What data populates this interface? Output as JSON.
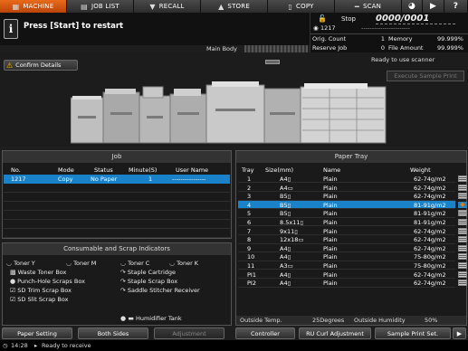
{
  "nav": {
    "tabs": [
      {
        "label": "MACHINE",
        "icon": "machine-icon"
      },
      {
        "label": "JOB LIST",
        "icon": "job-list-icon"
      },
      {
        "label": "RECALL",
        "icon": "recall-icon"
      },
      {
        "label": "STORE",
        "icon": "store-icon"
      },
      {
        "label": "COPY",
        "icon": "copy-icon"
      },
      {
        "label": "SCAN",
        "icon": "scan-icon"
      }
    ],
    "utility_icons": [
      "globe-icon",
      "volume-icon",
      "help-icon"
    ]
  },
  "message": {
    "icon": "i",
    "text": "Press [Start] to restart"
  },
  "status": {
    "state": "Stop",
    "counter": "0000/0001",
    "user": "1217",
    "user_dashes": "-----------------------",
    "orig_count_label": "Orig. Count",
    "orig_count_value": "1",
    "memory_label": "Memory",
    "memory_value": "99.999%",
    "reserve_job_label": "Reserve Job",
    "reserve_job_value": "0",
    "file_amount_label": "File Amount",
    "file_amount_value": "99.999%"
  },
  "machine": {
    "main_body_label": "Main Body",
    "confirm_details_label": "Confirm Details",
    "ready_text": "Ready to use scanner",
    "execute_sample_label": "Execute Sample Print"
  },
  "job": {
    "title": "Job",
    "headers": [
      "No.",
      "Mode",
      "Status",
      "Minute(S)",
      "User Name"
    ],
    "rows": [
      {
        "no": "1217",
        "mode": "Copy",
        "status": "No Paper",
        "minutes": "1",
        "user": "----------------"
      }
    ]
  },
  "consumables": {
    "title": "Consumable and Scrap Indicators",
    "items": [
      {
        "label": "Toner Y",
        "icon": "toner-y-icon"
      },
      {
        "label": "Toner M",
        "icon": "toner-m-icon"
      },
      {
        "label": "Toner C",
        "icon": "toner-c-icon"
      },
      {
        "label": "Toner K",
        "icon": "toner-k-icon"
      },
      {
        "label": "Waste Toner Box",
        "icon": "waste-toner-icon"
      },
      {
        "label": "Staple Cartridge",
        "icon": "staple-icon"
      },
      {
        "label": "Punch-Hole Scraps Box",
        "icon": "punch-icon"
      },
      {
        "label": "Staple Scrap Box",
        "icon": "staple-scrap-icon"
      },
      {
        "label": "SD Trim Scrap Box",
        "icon": "trim-icon"
      },
      {
        "label": "Saddle Stitcher Receiver",
        "icon": "saddle-icon"
      },
      {
        "label": "SD Slit Scrap Box",
        "icon": "slit-icon"
      },
      {
        "label": "Humidifier Tank",
        "icon": "humidifier-icon"
      }
    ]
  },
  "tray": {
    "title": "Paper Tray",
    "headers": [
      "Tray",
      "Size(mm)",
      "Name",
      "Weight"
    ],
    "rows": [
      {
        "tray": "1",
        "size": "A4▯",
        "name": "Plain",
        "weight": "62-74g/m2"
      },
      {
        "tray": "2",
        "size": "A4▭",
        "name": "Plain",
        "weight": "62-74g/m2"
      },
      {
        "tray": "3",
        "size": "B5▯",
        "name": "Plain",
        "weight": "62-74g/m2"
      },
      {
        "tray": "4",
        "size": "B5▯",
        "name": "Plain",
        "weight": "81-91g/m2"
      },
      {
        "tray": "5",
        "size": "B5▯",
        "name": "Plain",
        "weight": "81-91g/m2"
      },
      {
        "tray": "6",
        "size": "8.5x11▯",
        "name": "Plain",
        "weight": "81-91g/m2"
      },
      {
        "tray": "7",
        "size": "9x11▯",
        "name": "Plain",
        "weight": "62-74g/m2"
      },
      {
        "tray": "8",
        "size": "12x18▭",
        "name": "Plain",
        "weight": "62-74g/m2"
      },
      {
        "tray": "9",
        "size": "A4▯",
        "name": "Plain",
        "weight": "62-74g/m2"
      },
      {
        "tray": "10",
        "size": "A4▯",
        "name": "Plain",
        "weight": "75-80g/m2"
      },
      {
        "tray": "11",
        "size": "A3▭",
        "name": "Plain",
        "weight": "75-80g/m2"
      },
      {
        "tray": "PI1",
        "size": "A4▯",
        "name": "Plain",
        "weight": "62-74g/m2"
      },
      {
        "tray": "PI2",
        "size": "A4▯",
        "name": "Plain",
        "weight": "62-74g/m2"
      }
    ],
    "selected_index": 3,
    "outside_temp_label": "Outside Temp.",
    "outside_temp_value": "25Degrees",
    "outside_humidity_label": "Outside Humidity",
    "outside_humidity_value": "50%"
  },
  "bottom": {
    "paper_setting": "Paper Setting",
    "both_sides": "Both Sides",
    "adjustment": "Adjustment",
    "controller": "Controller",
    "ru_curl": "RU Curl Adjustment",
    "sample_print_set": "Sample Print Set."
  },
  "statusbar": {
    "time": "14:28",
    "state": "Ready to receive"
  }
}
